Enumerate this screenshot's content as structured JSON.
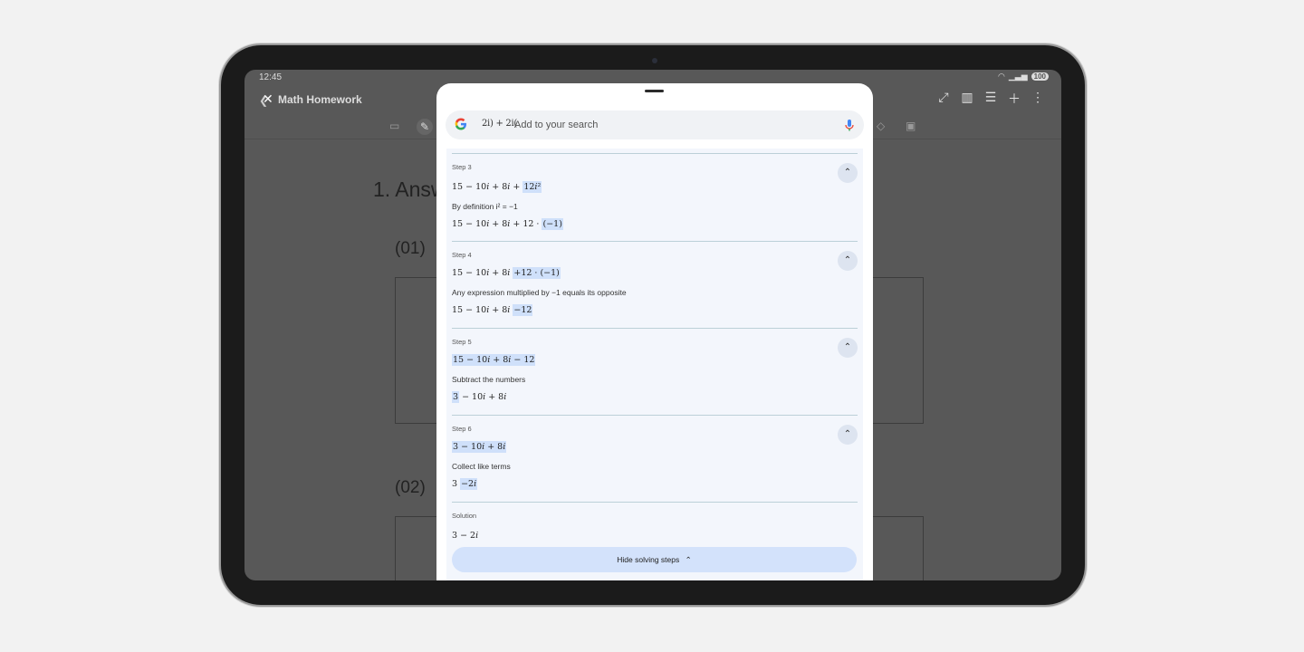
{
  "status": {
    "time": "12:45",
    "battery": "100"
  },
  "app": {
    "title": "Math Homework"
  },
  "note": {
    "question_heading": "1. Answ",
    "item1": "(01)",
    "item2": "(02)"
  },
  "search": {
    "chip": "2i) + 2i(",
    "placeholder": "Add to your search"
  },
  "steps": [
    {
      "title": "Step 3",
      "expr1": "15 − 10i + 8i + 12i²",
      "desc": "By definition i² = −1",
      "expr2": "15 − 10i + 8i + 12 · (−1)"
    },
    {
      "title": "Step 4",
      "expr1": "15 − 10i + 8i + 12 · (−1)",
      "desc": "Any expression multiplied by −1 equals its opposite",
      "expr2": "15 − 10i + 8i − 12"
    },
    {
      "title": "Step 5",
      "expr1": "15 − 10i + 8i − 12",
      "desc": "Subtract the numbers",
      "expr2": "3 − 10i + 8i"
    },
    {
      "title": "Step 6",
      "expr1": "3 − 10i + 8i",
      "desc": "Collect like terms",
      "expr2": "3 − 2i"
    }
  ],
  "solution": {
    "title": "Solution",
    "expr": "3 − 2i"
  },
  "hide_button": {
    "label": "Hide solving steps"
  },
  "colors": {
    "accent": "#d3e2fb",
    "highlight": "#cfe0fa",
    "panel": "#f3f6fc"
  }
}
